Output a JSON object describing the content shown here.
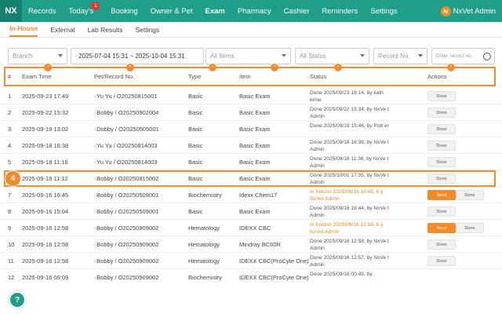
{
  "nav": {
    "brand": "NX",
    "items": [
      "Records",
      "Today's",
      "Booking",
      "Owner & Pet",
      "Exam",
      "Pharmacy",
      "Cashier",
      "Reminders",
      "Settings"
    ],
    "badge": "1",
    "user_initial": "N",
    "user_name": "NxVet Admin",
    "accent": "#1f9e8a"
  },
  "tabs": [
    "In-House",
    "External",
    "Lab Results",
    "Settings"
  ],
  "filters": {
    "branch": "Branch",
    "date_range": "2025-07-04 15:31 ~ 2025-10-04 15:31",
    "items": "All Items",
    "status": "All Status",
    "record_no": "Record No.",
    "search_placeholder": "Enter record no."
  },
  "markers": [
    "a",
    "b",
    "c",
    "d",
    "e",
    "f"
  ],
  "row_marker": "4",
  "columns": [
    "#",
    "Exam Time",
    "Pet/Record No.",
    "Type",
    "Item",
    "Status",
    "Actions"
  ],
  "rows": [
    {
      "no": "1",
      "time": "2025-09-23 17:49",
      "pet": "Yu Yu / O20250815001",
      "type": "Basic",
      "item": "Basic Exam",
      "status": "Done 2025/09/23 18:14, by kath erine",
      "status_color": "gray",
      "actions": [
        "Done"
      ]
    },
    {
      "no": "2",
      "time": "2025-09-22 15:32",
      "pet": "Bobby / O20250902004",
      "type": "Basic",
      "item": "Basic Exam",
      "status": "Done 2025/09/22 15:34, by NxVe t Admin",
      "status_color": "gray",
      "actions": [
        "Done"
      ]
    },
    {
      "no": "3",
      "time": "2025-09-19 13:02",
      "pet": "Dobby / O20250505001",
      "type": "Basic",
      "item": "Basic Exam",
      "status": "Done 2025/09/19 15:46, by Pott er",
      "status_color": "gray",
      "actions": [
        "Done"
      ]
    },
    {
      "no": "4",
      "time": "2025-09-18 16:38",
      "pet": "Yu Yu / O20250814003",
      "type": "Basic",
      "item": "Basic Exam",
      "status": "Done 2025/09/18 16:38, by NxVe t Admin",
      "status_color": "gray",
      "actions": [
        "Done"
      ]
    },
    {
      "no": "5",
      "time": "2025-09-18 11:16",
      "pet": "Yu Yu / O20250814003",
      "type": "Basic",
      "item": "Basic Exam",
      "status": "Done 2025/09/18 11:36, by NxVe t Admin",
      "status_color": "gray",
      "actions": [
        "Done"
      ]
    },
    {
      "no": "6",
      "time": "2025-09-18 11:12",
      "pet": "Bobby / O20250815002",
      "type": "Basic",
      "item": "Basic Exam",
      "status": "Done 2025/10/01 17:35, by NxVe t Admin",
      "status_color": "gray",
      "actions": [
        "Done"
      ]
    },
    {
      "no": "7",
      "time": "2025-09-16 16:45",
      "pet": "Bobby / O20250509001",
      "type": "Biochemistry",
      "item": "Idexx Chem17",
      "status": "In freezer 2025/09/16 16:45, b y NxVet Admin",
      "status_color": "orange",
      "actions": [
        "Send",
        "Done"
      ]
    },
    {
      "no": "8",
      "time": "2025-09-16 15:04",
      "pet": "Bobby / O20250509001",
      "type": "Basic",
      "item": "Basic Exam",
      "status": "Done 2025/09/16 16:44, by NxVe t Admin",
      "status_color": "gray",
      "actions": [
        "Done"
      ]
    },
    {
      "no": "9",
      "time": "2025-09-16 12:58",
      "pet": "Bobby / O20250909002",
      "type": "Hematology",
      "item": "IDEXX CBC",
      "status": "In freezer 2025/09/16 12:58, b y NxVet Admin",
      "status_color": "orange",
      "actions": [
        "Send",
        "Done"
      ]
    },
    {
      "no": "10",
      "time": "2025-09-16 12:58",
      "pet": "Bobby / O20250909002",
      "type": "Hematology",
      "item": "Mindray BC60R",
      "status": "Done 2025/09/16 12:58, by NxVe t Admin",
      "status_color": "gray",
      "actions": [
        "Done"
      ]
    },
    {
      "no": "11",
      "time": "2025-09-16 12:58",
      "pet": "Bobby / O20250909002",
      "type": "Hematology",
      "item": "IDEXX CBC(ProCyte One)",
      "status": "Done 2025/09/16 12:57, by NxVe t Admin",
      "status_color": "gray",
      "actions": [
        "Done"
      ]
    },
    {
      "no": "12",
      "time": "2025-09-16 09:09",
      "pet": "Bobby / O20250909002",
      "type": "Biochemistry",
      "item": "IDEXX CBC(ProCyte One)",
      "status": "Done 2025/09/16 00:49, by",
      "status_color": "gray",
      "actions": []
    }
  ],
  "help": "?"
}
